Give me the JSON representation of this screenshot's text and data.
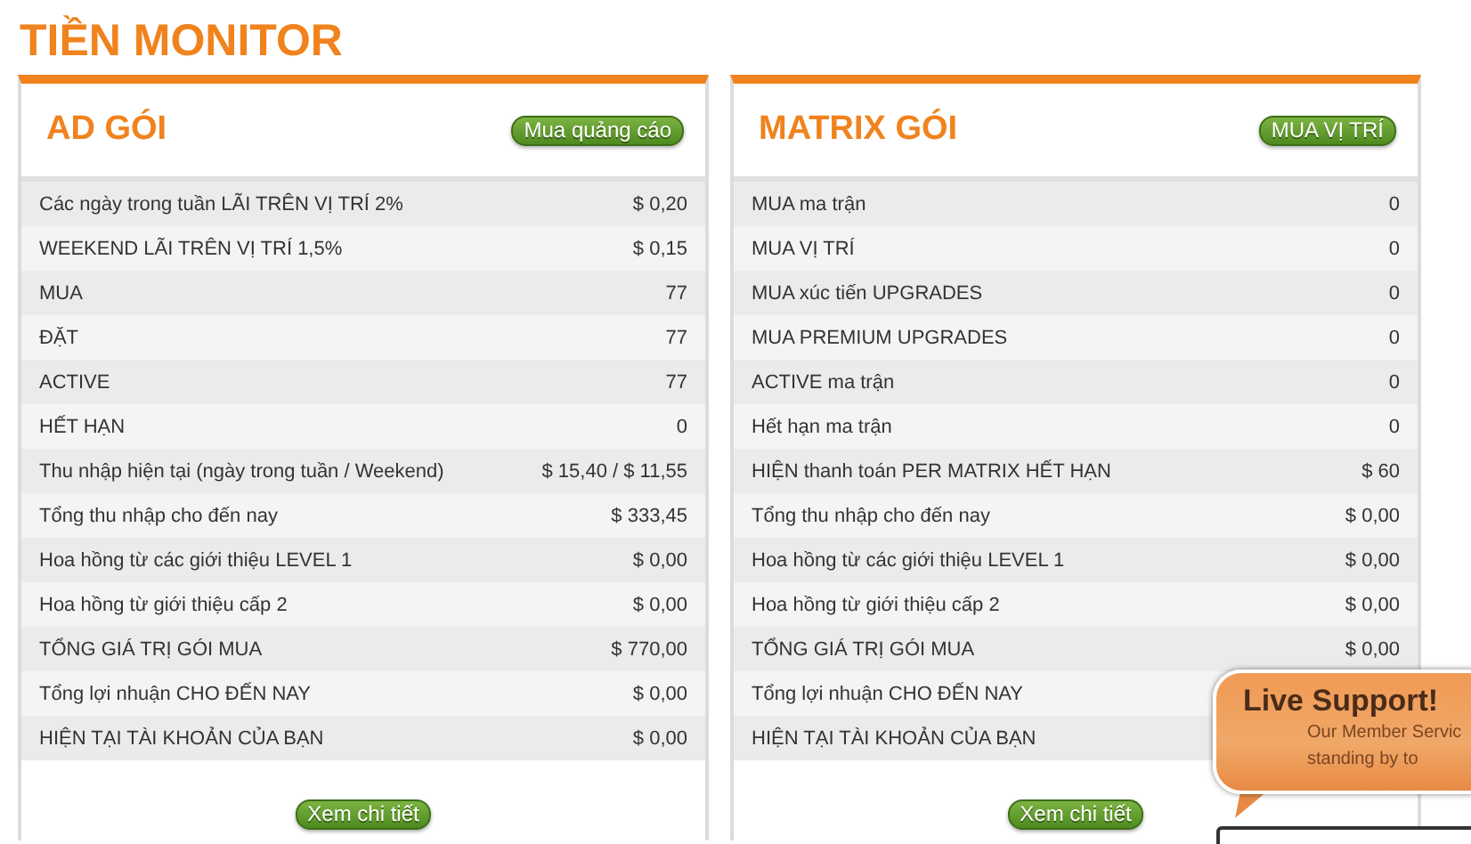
{
  "page_title": "TIỀN MONITOR",
  "panels": [
    {
      "title": "AD GÓI",
      "header_button": "Mua quảng cáo",
      "footer_button": "Xem chi tiết",
      "rows": [
        {
          "label": "Các ngày trong tuần LÃI TRÊN VỊ TRÍ 2%",
          "value": "$ 0,20"
        },
        {
          "label": "WEEKEND LÃI TRÊN VỊ TRÍ 1,5%",
          "value": "$ 0,15"
        },
        {
          "label": "MUA",
          "value": "77"
        },
        {
          "label": "ĐẶT",
          "value": "77"
        },
        {
          "label": "ACTIVE",
          "value": "77"
        },
        {
          "label": "HẾT HẠN",
          "value": "0"
        },
        {
          "label": "Thu nhập hiện tại (ngày trong tuần / Weekend)",
          "value": "$ 15,40 / $ 11,55"
        },
        {
          "label": "Tổng thu nhập cho đến nay",
          "value": "$ 333,45"
        },
        {
          "label": "Hoa hồng từ các giới thiệu LEVEL 1",
          "value": "$ 0,00"
        },
        {
          "label": "Hoa hồng từ giới thiệu cấp 2",
          "value": "$ 0,00"
        },
        {
          "label": "TỔNG GIÁ TRỊ GÓI MUA",
          "value": "$ 770,00"
        },
        {
          "label": "Tổng lợi nhuận CHO ĐẾN NAY",
          "value": "$ 0,00"
        },
        {
          "label": "HIỆN TẠI TÀI KHOẢN CỦA BẠN",
          "value": "$ 0,00"
        }
      ]
    },
    {
      "title": "MATRIX GÓI",
      "header_button": "MUA VỊ TRÍ",
      "footer_button": "Xem chi tiết",
      "rows": [
        {
          "label": "MUA ma trận",
          "value": "0"
        },
        {
          "label": "MUA VỊ TRÍ",
          "value": "0"
        },
        {
          "label": "MUA xúc tiến UPGRADES",
          "value": "0"
        },
        {
          "label": "MUA PREMIUM UPGRADES",
          "value": "0"
        },
        {
          "label": "ACTIVE ma trận",
          "value": "0"
        },
        {
          "label": "Hết hạn ma trận",
          "value": "0"
        },
        {
          "label": "HIỆN thanh toán PER MATRIX HẾT HẠN",
          "value": "$ 60"
        },
        {
          "label": "Tổng thu nhập cho đến nay",
          "value": "$ 0,00"
        },
        {
          "label": "Hoa hồng từ các giới thiệu LEVEL 1",
          "value": "$ 0,00"
        },
        {
          "label": "Hoa hồng từ giới thiệu cấp 2",
          "value": "$ 0,00"
        },
        {
          "label": "TỔNG GIÁ TRỊ GÓI MUA",
          "value": "$ 0,00"
        },
        {
          "label": "Tổng lợi nhuận CHO ĐẾN NAY"
        },
        {
          "label": "HIỆN TẠI TÀI KHOẢN CỦA BẠN"
        }
      ]
    }
  ],
  "live_support": {
    "title": "Live Support!",
    "lines": [
      "Our Member Servic",
      "standing by to"
    ]
  }
}
